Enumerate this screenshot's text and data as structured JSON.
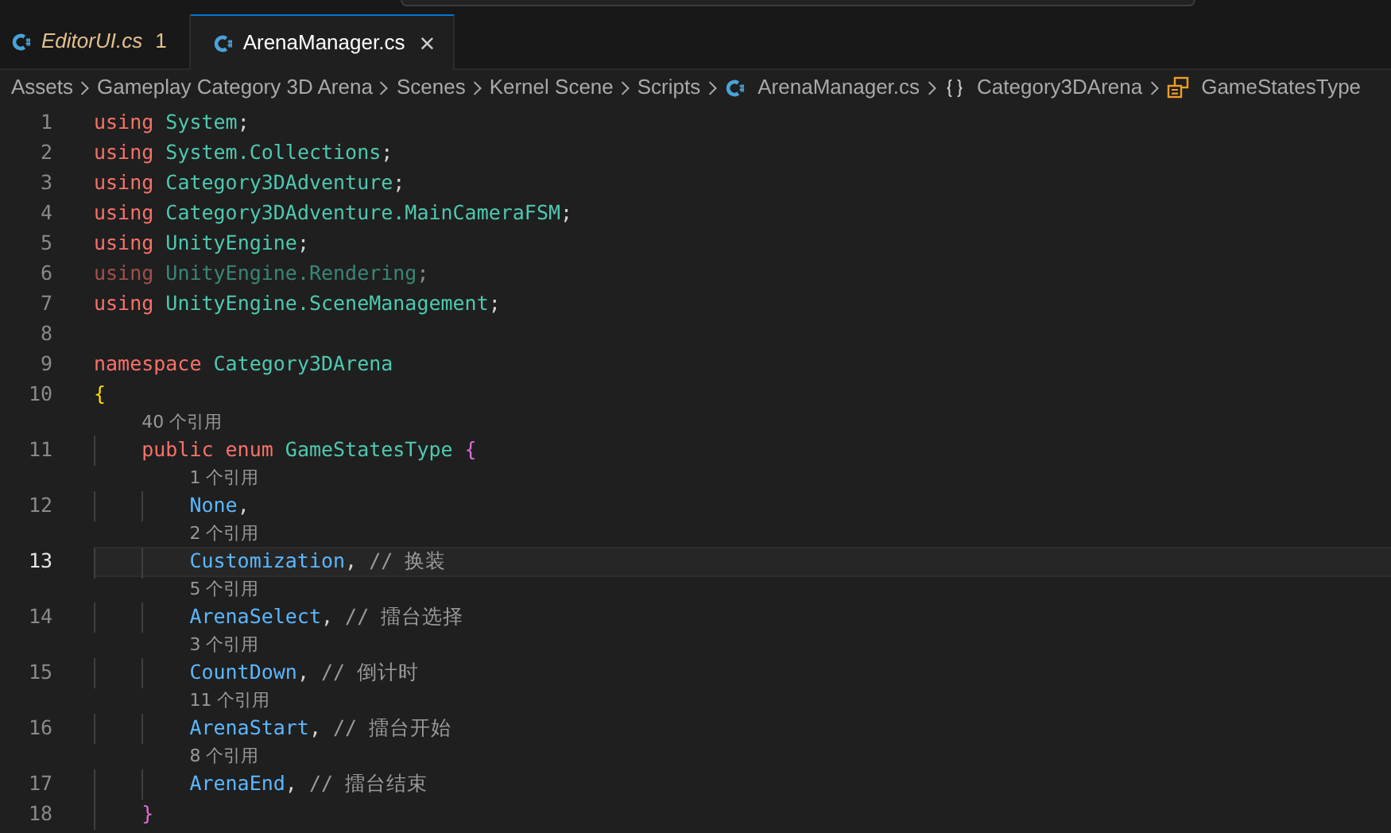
{
  "tabs": [
    {
      "label": "EditorUI.cs",
      "selected": false,
      "preview": true,
      "problem_count": "1"
    },
    {
      "label": "ArenaManager.cs",
      "selected": true,
      "preview": false,
      "close": "×"
    }
  ],
  "breadcrumb": [
    {
      "kind": "folder",
      "label": "Assets"
    },
    {
      "kind": "folder",
      "label": "Gameplay Category 3D Arena"
    },
    {
      "kind": "folder",
      "label": "Scenes"
    },
    {
      "kind": "folder",
      "label": "Kernel Scene"
    },
    {
      "kind": "folder",
      "label": "Scripts"
    },
    {
      "kind": "file",
      "label": "ArenaManager.cs"
    },
    {
      "kind": "namespace",
      "label": "Category3DArena"
    },
    {
      "kind": "enum",
      "label": "GameStatesType"
    }
  ],
  "lines": [
    {
      "number": "1",
      "current": false,
      "dimmed": false,
      "tokens": [
        {
          "kind": "keyword",
          "text": "using"
        },
        {
          "kind": "type",
          "text": " System"
        },
        {
          "kind": "plain",
          "text": ";"
        }
      ]
    },
    {
      "number": "2",
      "current": false,
      "dimmed": false,
      "tokens": [
        {
          "kind": "keyword",
          "text": "using"
        },
        {
          "kind": "type",
          "text": " System.Collections"
        },
        {
          "kind": "plain",
          "text": ";"
        }
      ]
    },
    {
      "number": "3",
      "current": false,
      "dimmed": false,
      "tokens": [
        {
          "kind": "keyword",
          "text": "using"
        },
        {
          "kind": "type",
          "text": " Category3DAdventure"
        },
        {
          "kind": "plain",
          "text": ";"
        }
      ]
    },
    {
      "number": "4",
      "current": false,
      "dimmed": false,
      "tokens": [
        {
          "kind": "keyword",
          "text": "using"
        },
        {
          "kind": "type",
          "text": " Category3DAdventure.MainCameraFSM"
        },
        {
          "kind": "plain",
          "text": ";"
        }
      ]
    },
    {
      "number": "5",
      "current": false,
      "dimmed": false,
      "tokens": [
        {
          "kind": "keyword",
          "text": "using"
        },
        {
          "kind": "type",
          "text": " UnityEngine"
        },
        {
          "kind": "plain",
          "text": ";"
        }
      ]
    },
    {
      "number": "6",
      "current": false,
      "dimmed": true,
      "tokens": [
        {
          "kind": "keyword",
          "text": "using"
        },
        {
          "kind": "type",
          "text": " UnityEngine.Rendering"
        },
        {
          "kind": "plain",
          "text": ";"
        }
      ]
    },
    {
      "number": "7",
      "current": false,
      "dimmed": false,
      "tokens": [
        {
          "kind": "keyword",
          "text": "using"
        },
        {
          "kind": "type",
          "text": " UnityEngine.SceneManagement"
        },
        {
          "kind": "plain",
          "text": ";"
        }
      ]
    },
    {
      "number": "8",
      "current": false
    },
    {
      "number": "9",
      "current": false,
      "dimmed": false,
      "tokens": [
        {
          "kind": "keyword",
          "text": "namespace"
        },
        {
          "kind": "type",
          "text": " Category3DArena"
        }
      ]
    },
    {
      "number": "10",
      "current": false,
      "dimmed": false,
      "tokens": [
        {
          "kind": "brace1",
          "text": "{"
        }
      ]
    },
    {
      "number": "11",
      "current": false,
      "dimmed": false,
      "references": "40 个引用",
      "tokens": [
        {
          "kind": "keyword",
          "text": "    public enum"
        },
        {
          "kind": "type",
          "text": " GameStatesType"
        },
        {
          "kind": "brace2",
          "text": " {"
        }
      ]
    },
    {
      "number": "12",
      "current": false,
      "dimmed": false,
      "references": "1 个引用",
      "tokens": [
        {
          "kind": "member",
          "text": "        None"
        },
        {
          "kind": "plain",
          "text": ","
        }
      ]
    },
    {
      "number": "13",
      "current": true,
      "dimmed": false,
      "references": "2 个引用",
      "tokens": [
        {
          "kind": "member",
          "text": "        Customization"
        },
        {
          "kind": "plain",
          "text": ","
        },
        {
          "kind": "comment",
          "text": " // 换装"
        }
      ]
    },
    {
      "number": "14",
      "current": false,
      "dimmed": false,
      "references": "5 个引用",
      "tokens": [
        {
          "kind": "member",
          "text": "        ArenaSelect"
        },
        {
          "kind": "plain",
          "text": ","
        },
        {
          "kind": "comment",
          "text": " // 擂台选择"
        }
      ]
    },
    {
      "number": "15",
      "current": false,
      "dimmed": false,
      "references": "3 个引用",
      "tokens": [
        {
          "kind": "member",
          "text": "        CountDown"
        },
        {
          "kind": "plain",
          "text": ","
        },
        {
          "kind": "comment",
          "text": " // 倒计时"
        }
      ]
    },
    {
      "number": "16",
      "current": false,
      "dimmed": false,
      "references": "11 个引用",
      "tokens": [
        {
          "kind": "member",
          "text": "        ArenaStart"
        },
        {
          "kind": "plain",
          "text": ","
        },
        {
          "kind": "comment",
          "text": " // 擂台开始"
        }
      ]
    },
    {
      "number": "17",
      "current": false,
      "dimmed": false,
      "references": "8 个引用",
      "tokens": [
        {
          "kind": "member",
          "text": "        ArenaEnd"
        },
        {
          "kind": "plain",
          "text": ","
        },
        {
          "kind": "comment",
          "text": " // 擂台结束"
        }
      ]
    },
    {
      "number": "18",
      "current": false,
      "dimmed": false,
      "tokens": [
        {
          "kind": "brace2",
          "text": "    }"
        }
      ]
    }
  ]
}
